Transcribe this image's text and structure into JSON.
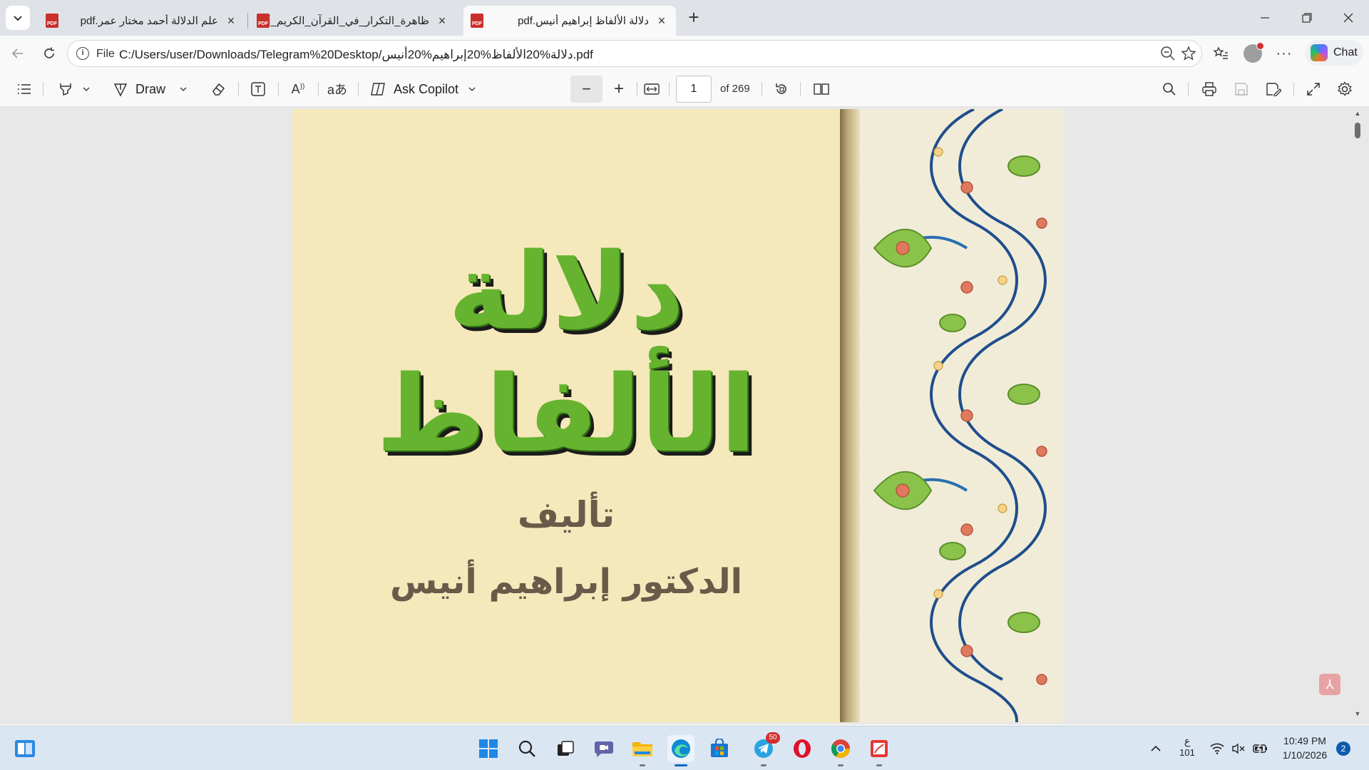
{
  "tabs": [
    {
      "title": "علم الدلالة أحمد مختار عمر.pdf",
      "active": false
    },
    {
      "title": "ظاهرة_التكرار_في_القرآن_الكريم_أغراضه",
      "active": false
    },
    {
      "title": "دلالة الألفاظ إبراهيم أنيس.pdf",
      "active": true
    }
  ],
  "addressbar": {
    "scheme_label": "File",
    "url": "C:/Users/user/Downloads/Telegram%20Desktop/دلالة%20الألفاظ%20إبراهيم%20أنيس.pdf"
  },
  "chat_button": {
    "label": "Chat"
  },
  "pdf_toolbar": {
    "draw_label": "Draw",
    "ask_copilot_label": "Ask Copilot",
    "page_current": "1",
    "page_total": "of 269"
  },
  "document": {
    "title": "دلالة الألفاظ",
    "authored_label": "تأليف",
    "author": "الدكتور إبراهيم أنيس"
  },
  "taskbar": {
    "telegram_badge": "50",
    "lang_indicator": "ع",
    "lang_sub": "101",
    "time": "10:49 PM",
    "date": "1/10/2026",
    "notification_count": "2"
  },
  "colors": {
    "title_green": "#66b32f",
    "page_cream": "#f5e9bc",
    "author_brown": "#6a5a49",
    "accent_blue": "#0067c0"
  }
}
